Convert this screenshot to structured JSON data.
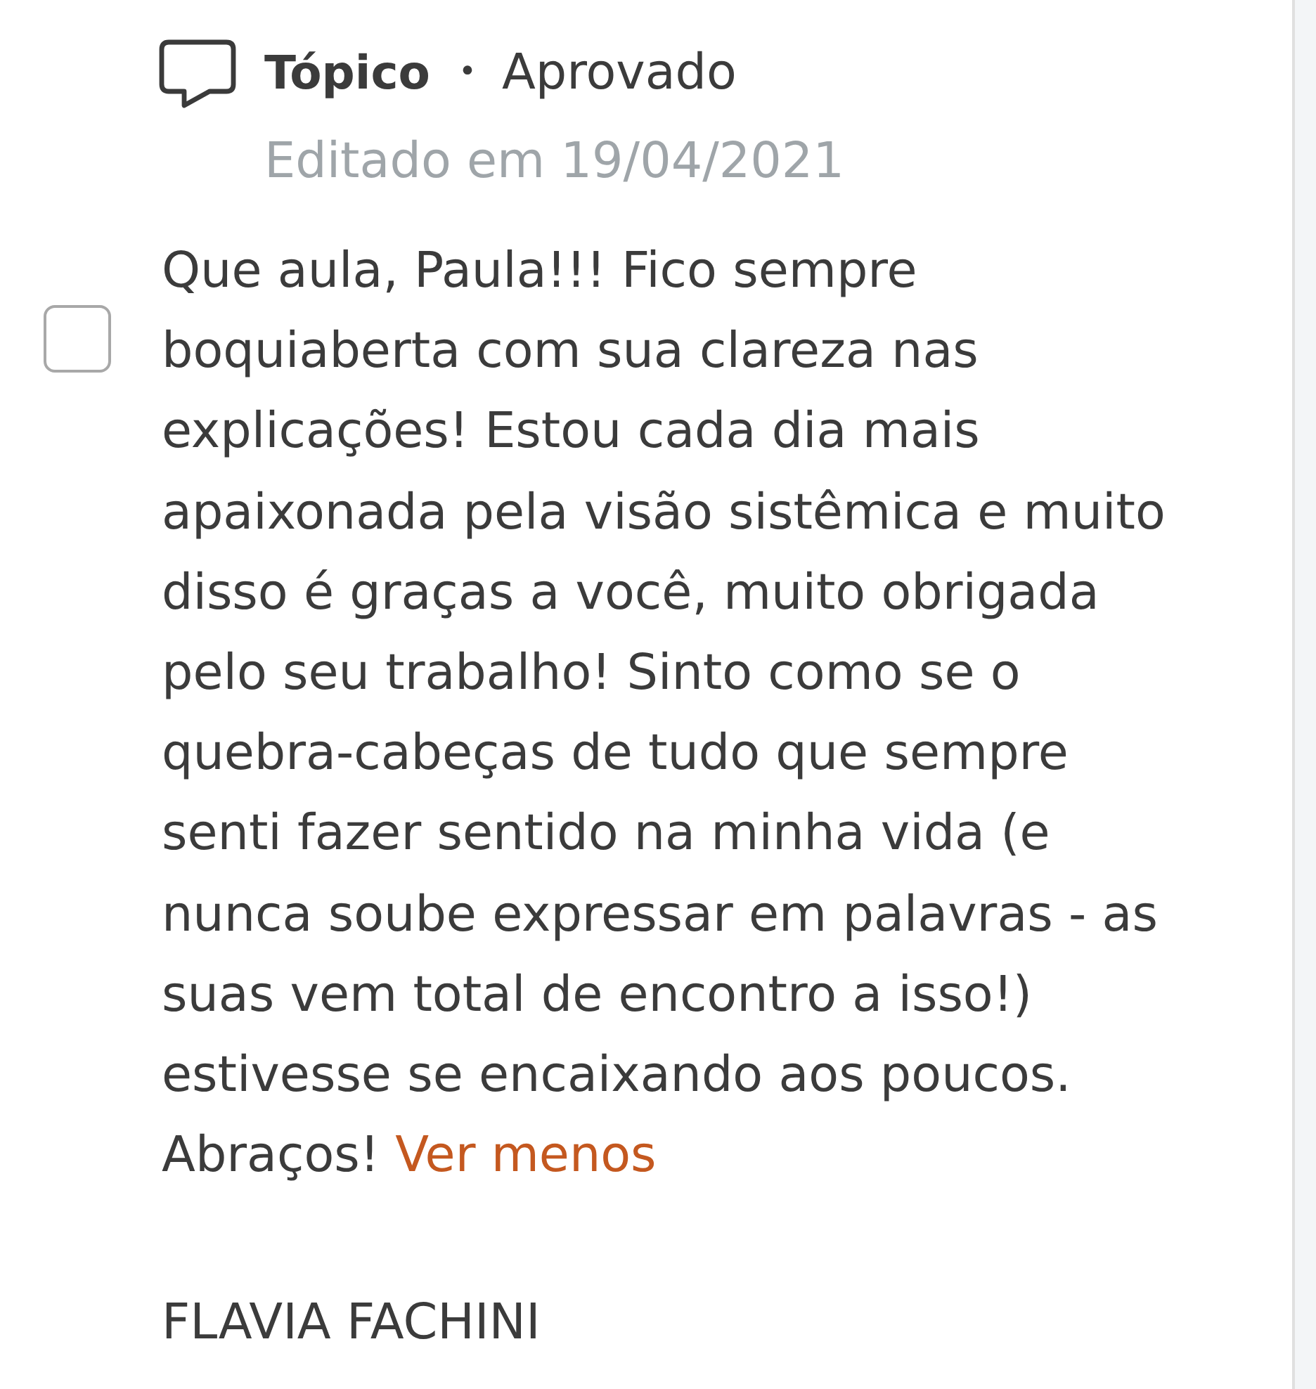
{
  "post": {
    "type": "Tópico",
    "separator": "•",
    "status": "Aprovado",
    "edited": "Editado em 19/04/2021",
    "checked": false,
    "body": "Que aula, Paula!!! Fico sempre boquiaberta com sua clareza nas explicações! Estou cada dia mais apaixonada pela visão sistêmica e muito disso é graças a você, muito obrigada pelo seu trabalho! Sinto como se o quebra-cabeças de tudo que sempre senti fazer sentido na minha vida (e nunca soube expressar em palavras - as suas vem total de encontro a isso!) estivesse se encaixando aos poucos. Abraços!",
    "toggle_link": "Ver menos",
    "author": "FLAVIA FACHINI"
  }
}
